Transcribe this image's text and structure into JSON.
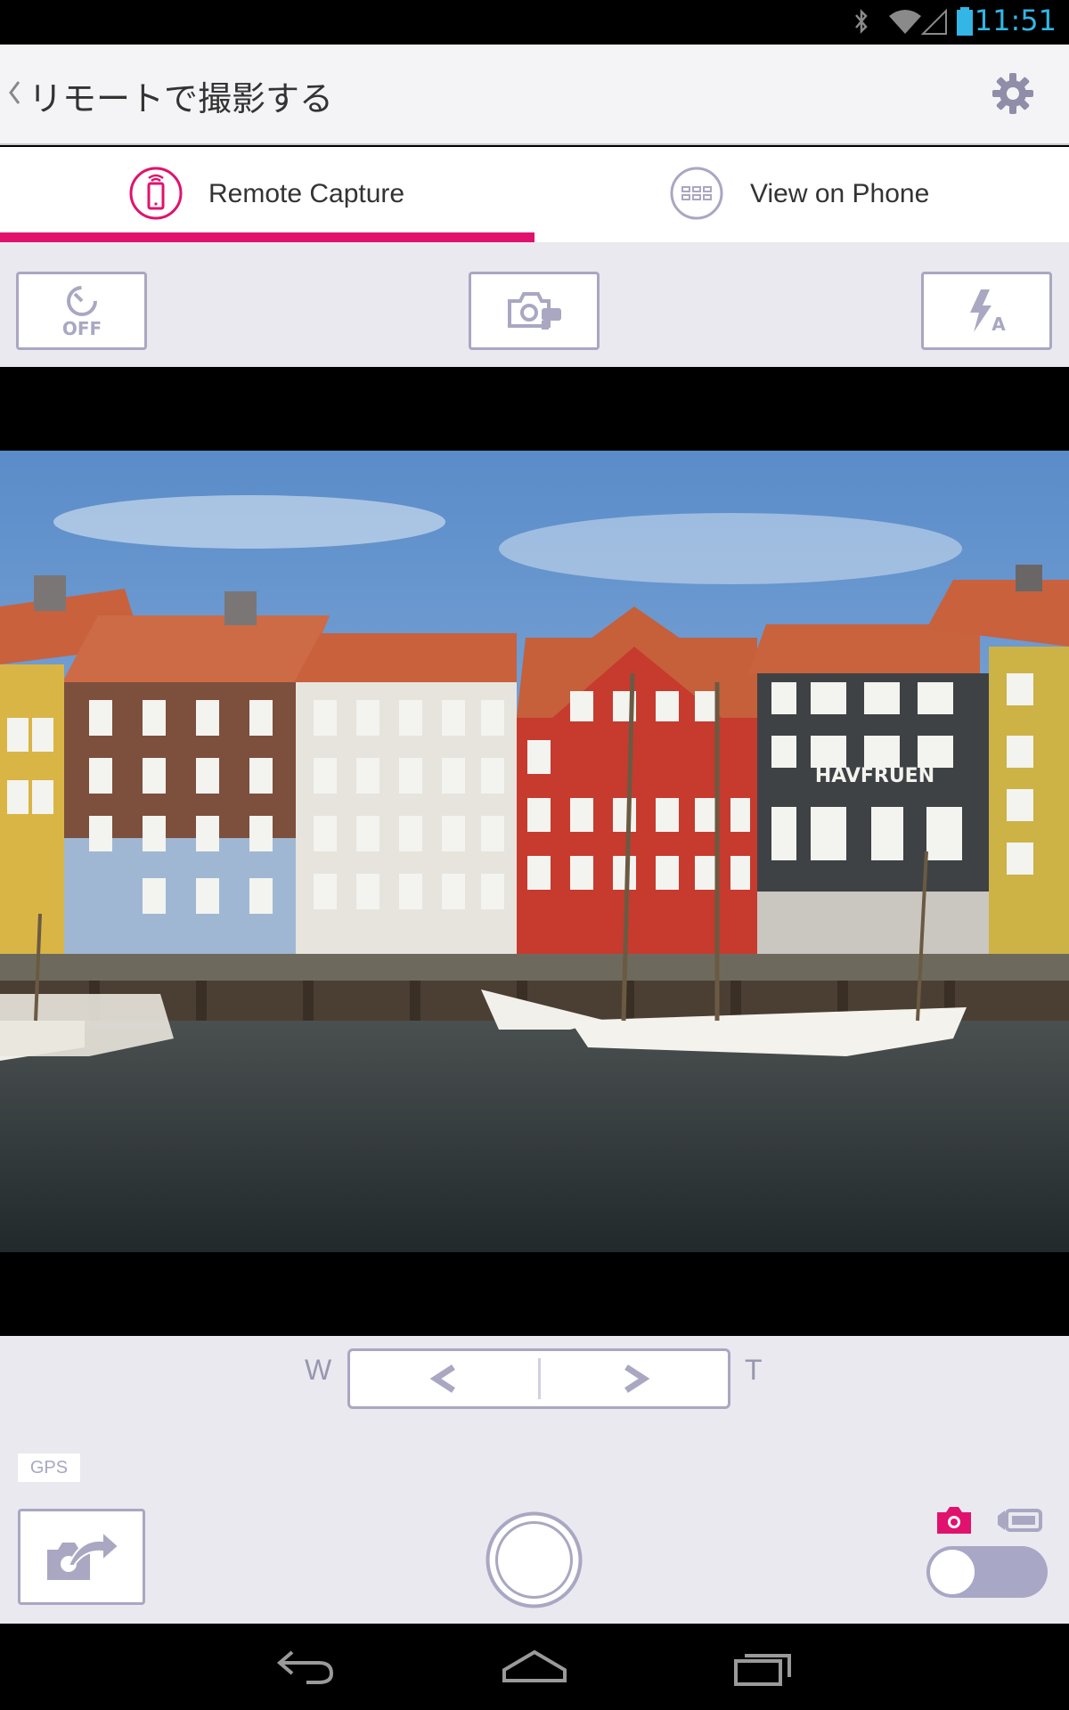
{
  "status_bar": {
    "time": "11:51"
  },
  "header": {
    "title": "リモートで撮影する"
  },
  "tabs": [
    {
      "label": "Remote Capture",
      "icon": "phone-remote-icon",
      "active": true
    },
    {
      "label": "View on Phone",
      "icon": "grid-view-icon",
      "active": false
    }
  ],
  "toolbar": {
    "self_timer_label": "OFF",
    "flash_mode_label": "A"
  },
  "preview": {
    "photo_sign": "HAVFRUEN"
  },
  "zoom": {
    "wide_label": "W",
    "tele_label": "T"
  },
  "controls": {
    "gps_label": "GPS",
    "mode": "photo"
  },
  "colors": {
    "accent": "#e0126e",
    "frame": "#a9a7c2",
    "background": "#e9e9ef",
    "status": "#33b5e5"
  }
}
